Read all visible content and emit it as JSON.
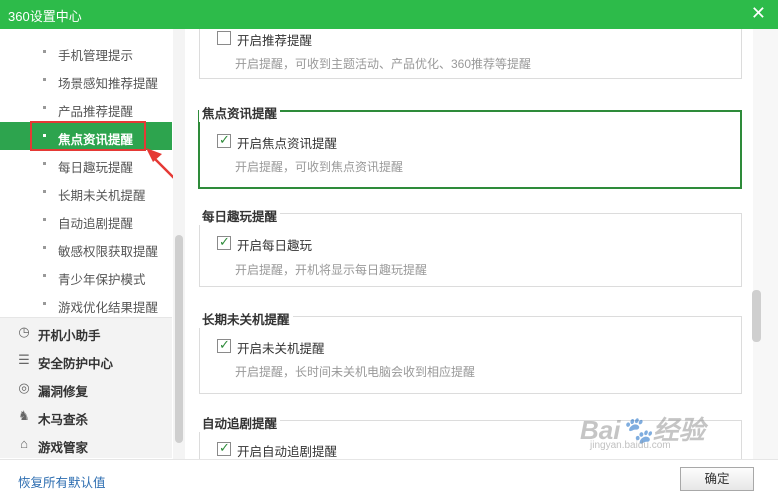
{
  "window": {
    "title": "360设置中心",
    "close_glyph": "✕"
  },
  "sidebar": {
    "sub_items": [
      {
        "label": "手机管理提示"
      },
      {
        "label": "场景感知推荐提醒"
      },
      {
        "label": "产品推荐提醒"
      },
      {
        "label": "焦点资讯提醒",
        "active": true
      },
      {
        "label": "每日趣玩提醒"
      },
      {
        "label": "长期未关机提醒"
      },
      {
        "label": "自动追剧提醒"
      },
      {
        "label": "敏感权限获取提醒"
      },
      {
        "label": "青少年保护模式"
      },
      {
        "label": "游戏优化结果提醒"
      }
    ],
    "categories": [
      {
        "label": "开机小助手",
        "icon": "clock-icon"
      },
      {
        "label": "安全防护中心",
        "icon": "list-icon"
      },
      {
        "label": "漏洞修复",
        "icon": "target-icon"
      },
      {
        "label": "木马查杀",
        "icon": "horse-icon"
      },
      {
        "label": "游戏管家",
        "icon": "gamepad-icon"
      }
    ]
  },
  "sections": [
    {
      "title": "",
      "checkbox_label": "开启推荐提醒",
      "checked": false,
      "desc": "开启提醒，可收到主题活动、产品优化、360推荐等提醒"
    },
    {
      "title": "焦点资讯提醒",
      "checkbox_label": "开启焦点资讯提醒",
      "checked": true,
      "desc": "开启提醒，可收到焦点资讯提醒"
    },
    {
      "title": "每日趣玩提醒",
      "checkbox_label": "开启每日趣玩",
      "checked": true,
      "desc": "开启提醒，开机将显示每日趣玩提醒"
    },
    {
      "title": "长期未关机提醒",
      "checkbox_label": "开启未关机提醒",
      "checked": true,
      "desc": "开启提醒，长时间未关机电脑会收到相应提醒"
    },
    {
      "title": "自动追剧提醒",
      "checkbox_label": "开启自动追剧提醒",
      "checked": true,
      "desc": ""
    }
  ],
  "footer": {
    "restore_label": "恢复所有默认值",
    "ok_label": "确定"
  },
  "watermark": {
    "text": "Bai🐾经验",
    "sub": "jingyan.baidu.com"
  },
  "colors": {
    "brand_green": "#2dbb4a",
    "active_bg": "#2da44e",
    "highlight_red": "#e53935"
  }
}
